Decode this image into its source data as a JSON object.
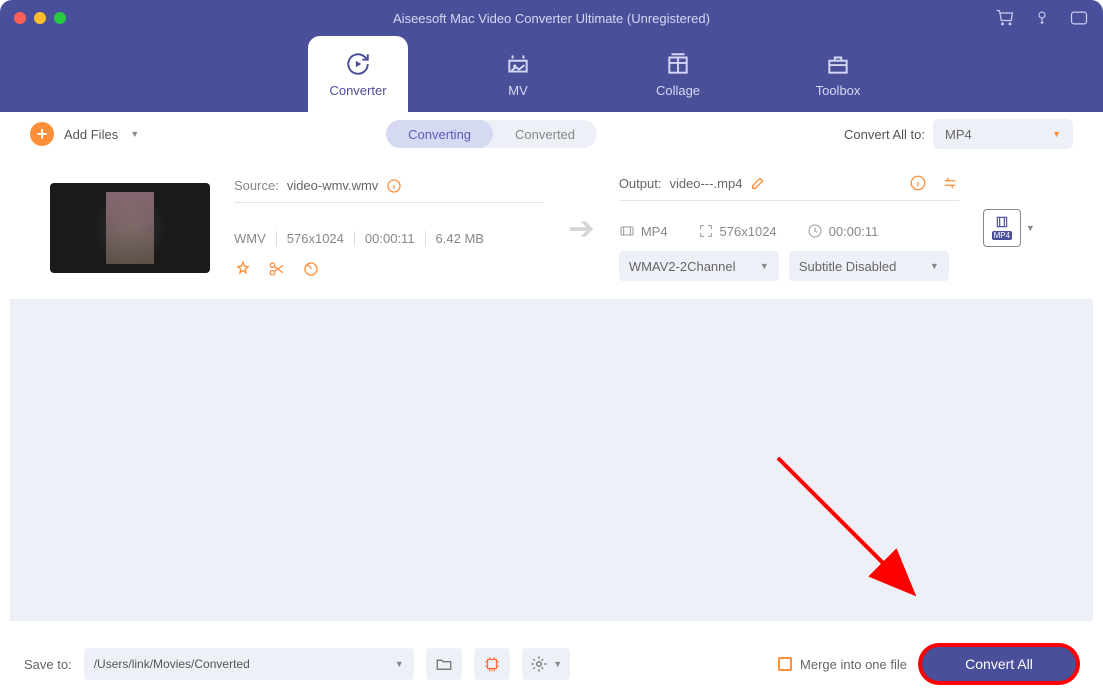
{
  "title": "Aiseesoft Mac Video Converter Ultimate (Unregistered)",
  "nav": {
    "converter": "Converter",
    "mv": "MV",
    "collage": "Collage",
    "toolbox": "Toolbox"
  },
  "toolbar": {
    "add_files": "Add Files",
    "converting_tab": "Converting",
    "converted_tab": "Converted",
    "convert_all_to_label": "Convert All to:",
    "convert_all_to_value": "MP4"
  },
  "file": {
    "source_label": "Source:",
    "source_name": "video-wmv.wmv",
    "meta": {
      "format": "WMV",
      "resolution": "576x1024",
      "duration": "00:00:11",
      "size": "6.42 MB"
    },
    "output_label": "Output:",
    "output_name": "video---.mp4",
    "out_format": "MP4",
    "out_resolution": "576x1024",
    "out_duration": "00:00:11",
    "audio_dd": "WMAV2-2Channel",
    "subtitle_dd": "Subtitle Disabled",
    "fmt_badge": "MP4"
  },
  "bottom": {
    "save_to_label": "Save to:",
    "save_to_path": "/Users/link/Movies/Converted",
    "merge_label": "Merge into one file",
    "convert_all_btn": "Convert All"
  }
}
